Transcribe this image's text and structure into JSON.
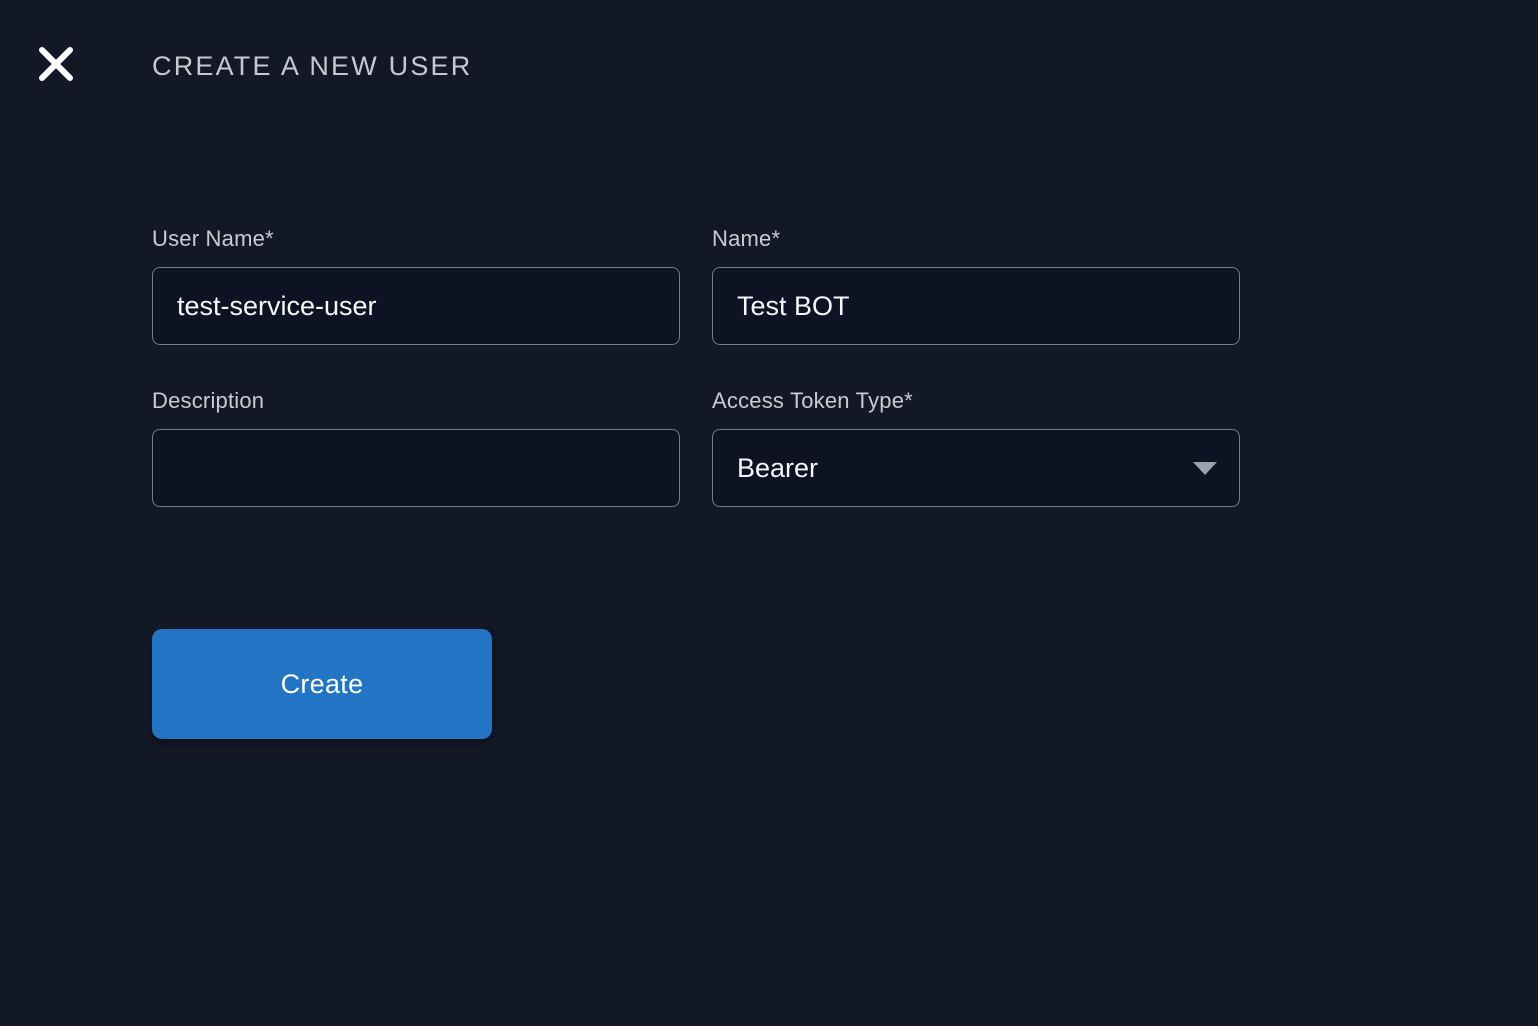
{
  "page": {
    "title": "CREATE A NEW USER"
  },
  "form": {
    "user_name": {
      "label": "User Name",
      "required_marker": "*",
      "value": "test-service-user"
    },
    "name": {
      "label": "Name",
      "required_marker": "*",
      "value": "Test BOT"
    },
    "description": {
      "label": "Description",
      "required_marker": "",
      "value": "",
      "placeholder": ""
    },
    "access_token_type": {
      "label": "Access Token Type",
      "required_marker": "*",
      "value": "Bearer"
    }
  },
  "actions": {
    "create_label": "Create"
  },
  "icons": {
    "close": "close-icon",
    "dropdown": "chevron-down-icon"
  },
  "colors": {
    "background": "#121826",
    "input_background": "#0D1322",
    "input_border": "#767E8A",
    "label_text": "#C8CCD2",
    "value_text": "#F4F6F8",
    "title_text": "#C5CAD1",
    "accent_blue": "#2274C4",
    "caret_gray": "#9BA1A9"
  }
}
